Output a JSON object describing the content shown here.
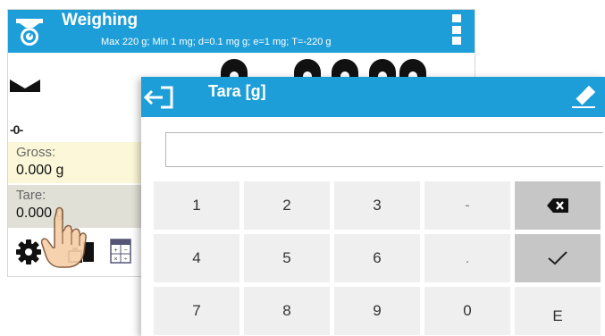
{
  "background_screen": {
    "title": "Weighing",
    "metrology": "Max 220 g; Min 1 mg; d=0.1 mg g; e=1 mg; T=-220 g",
    "zero_indicator": "-0-",
    "gross": {
      "label": "Gross:",
      "value": "0.000 g"
    },
    "tare": {
      "label": "Tare:",
      "value": "0.000 g"
    }
  },
  "dialog": {
    "title": "Tara [g]",
    "input_value": "",
    "keys": {
      "k1": "1",
      "k2": "2",
      "k3": "3",
      "minus": "-",
      "k4": "4",
      "k5": "5",
      "k6": "6",
      "dot": ".",
      "k7": "7",
      "k8": "8",
      "k9": "9",
      "k0": "0",
      "e": "E"
    }
  },
  "colors": {
    "header": "#1e9ed8",
    "key": "#efefef",
    "key_dark": "#c6c6c6",
    "gross_bg": "#fbf7d8"
  },
  "icons": [
    "scale-icon",
    "menu-icon",
    "stable-icon",
    "gear-icon",
    "tare-key-icon",
    "calculator-icon",
    "hand-pointer-icon",
    "back-icon",
    "eraser-icon",
    "backspace-icon",
    "checkmark-icon"
  ]
}
